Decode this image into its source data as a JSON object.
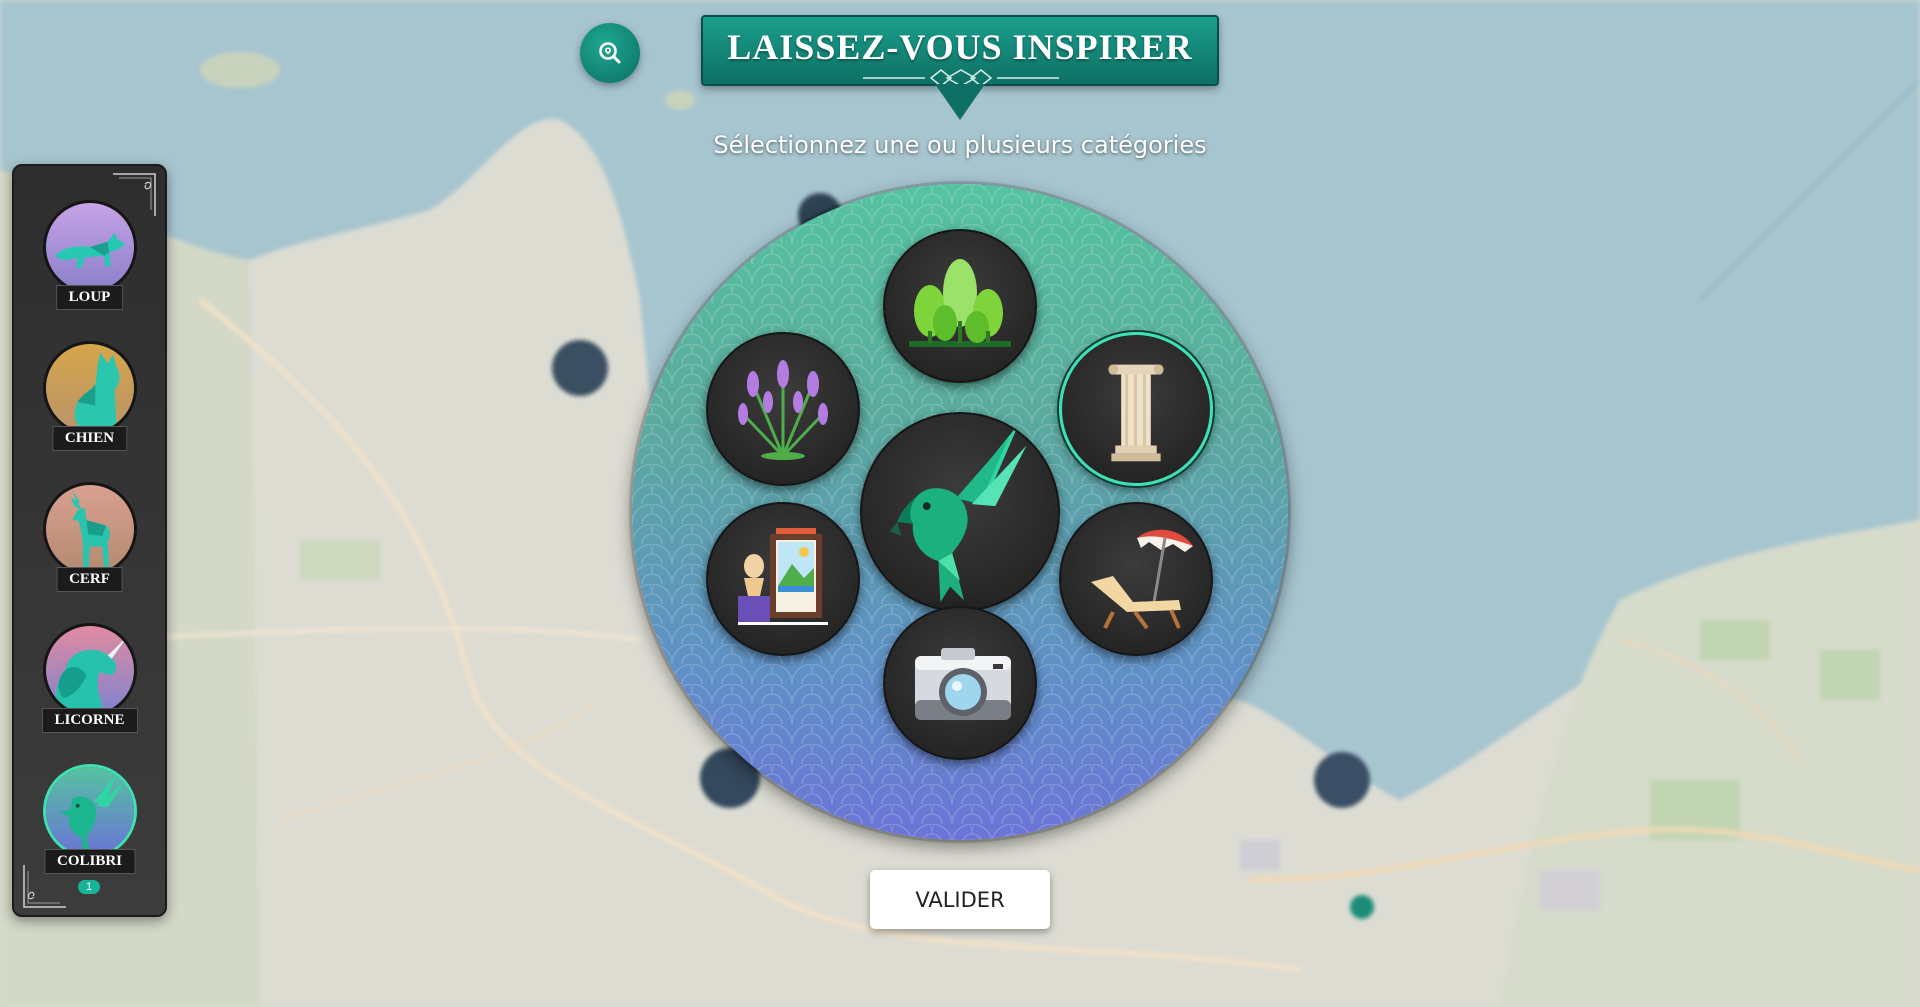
{
  "header": {
    "title": "LAISSEZ-VOUS INSPIRER",
    "subtitle": "Sélectionnez une ou plusieurs catégories",
    "search_icon": "search-location-icon"
  },
  "sidebar": {
    "avatars": [
      {
        "label": "LOUP",
        "icon": "wolf-icon"
      },
      {
        "label": "CHIEN",
        "icon": "dog-icon"
      },
      {
        "label": "CERF",
        "icon": "deer-icon"
      },
      {
        "label": "LICORNE",
        "icon": "unicorn-icon"
      },
      {
        "label": "COLIBRI",
        "icon": "hummingbird-icon",
        "badge": "1",
        "selected": true
      }
    ]
  },
  "wheel": {
    "center_icon": "parrot-icon",
    "categories": [
      {
        "id": "forest",
        "icon": "forest-icon",
        "selected": false
      },
      {
        "id": "lavender",
        "icon": "lavender-icon",
        "selected": false
      },
      {
        "id": "monument",
        "icon": "column-icon",
        "selected": true
      },
      {
        "id": "museum",
        "icon": "museum-art-icon",
        "selected": false
      },
      {
        "id": "beach",
        "icon": "beach-chair-icon",
        "selected": false
      },
      {
        "id": "photo",
        "icon": "camera-icon",
        "selected": false
      }
    ]
  },
  "actions": {
    "validate_label": "VALIDER"
  },
  "colors": {
    "teal_primary": "#14907f",
    "teal_dark": "#0e6f64",
    "selected_ring": "#3fe0b4",
    "wheel_top": "#55c3a0",
    "wheel_bottom": "#6b74d6"
  }
}
